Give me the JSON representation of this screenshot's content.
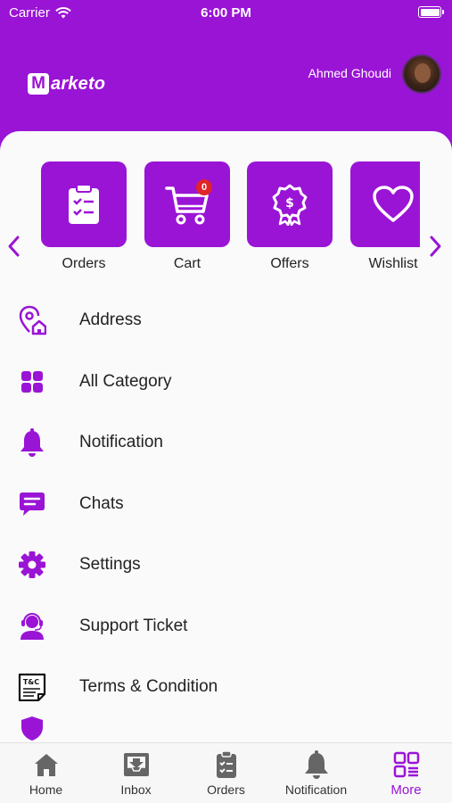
{
  "status_bar": {
    "carrier": "Carrier",
    "time": "6:00 PM"
  },
  "header": {
    "logo_letter": "M",
    "logo_text": "arketo",
    "user_name": "Ahmed Ghoudi"
  },
  "quick_actions": [
    {
      "label": "Orders",
      "icon": "clipboard-icon"
    },
    {
      "label": "Cart",
      "icon": "cart-icon",
      "badge": "0"
    },
    {
      "label": "Offers",
      "icon": "offer-badge-icon"
    },
    {
      "label": "Wishlist",
      "icon": "heart-icon"
    }
  ],
  "menu": [
    {
      "label": "Address",
      "icon": "location-home-icon"
    },
    {
      "label": "All Category",
      "icon": "grid-icon"
    },
    {
      "label": "Notification",
      "icon": "bell-icon"
    },
    {
      "label": "Chats",
      "icon": "chat-icon"
    },
    {
      "label": "Settings",
      "icon": "gear-icon"
    },
    {
      "label": "Support Ticket",
      "icon": "support-agent-icon"
    },
    {
      "label": "Terms & Condition",
      "icon": "terms-document-icon",
      "icon_text": "T&C"
    }
  ],
  "tabbar": [
    {
      "label": "Home",
      "icon": "home-icon"
    },
    {
      "label": "Inbox",
      "icon": "inbox-icon"
    },
    {
      "label": "Orders",
      "icon": "clipboard-icon"
    },
    {
      "label": "Notification",
      "icon": "bell-icon"
    },
    {
      "label": "More",
      "icon": "grid-more-icon",
      "active": true
    }
  ],
  "colors": {
    "primary": "#9a14d6",
    "badge": "#e0242a",
    "text": "#222222",
    "tab_inactive": "#666666"
  }
}
